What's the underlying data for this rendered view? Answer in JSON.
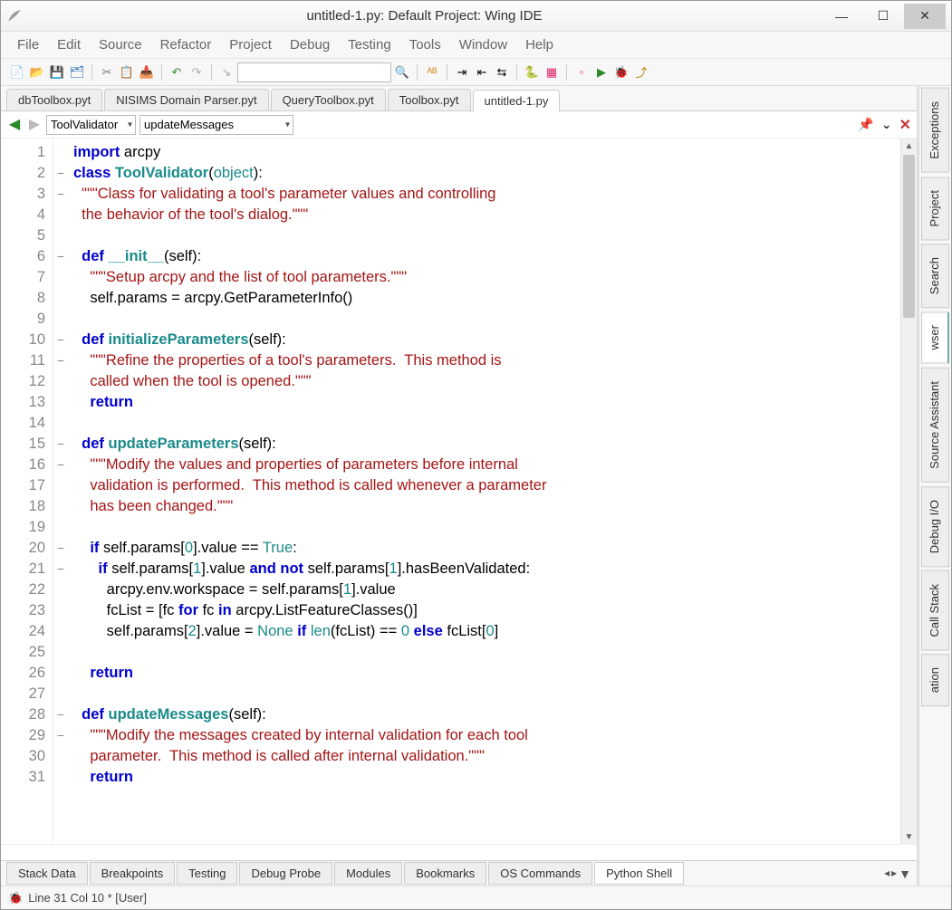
{
  "window": {
    "title": "untitled-1.py: Default Project: Wing IDE"
  },
  "menus": [
    "File",
    "Edit",
    "Source",
    "Refactor",
    "Project",
    "Debug",
    "Testing",
    "Tools",
    "Window",
    "Help"
  ],
  "tabs_top": [
    {
      "label": "dbToolbox.pyt",
      "active": false
    },
    {
      "label": "NISIMS Domain Parser.pyt",
      "active": false
    },
    {
      "label": "QueryToolbox.pyt",
      "active": false
    },
    {
      "label": "Toolbox.pyt",
      "active": false
    },
    {
      "label": "untitled-1.py",
      "active": true
    }
  ],
  "nav": {
    "scope1": "ToolValidator",
    "scope2": "updateMessages"
  },
  "code": {
    "lines": [
      {
        "n": 1,
        "fold": "",
        "html": "<span class='kw'>import</span> arcpy"
      },
      {
        "n": 2,
        "fold": "−",
        "html": "<span class='kw'>class</span> <span class='cls'>ToolValidator</span>(<span class='obj'>object</span>):"
      },
      {
        "n": 3,
        "fold": "−",
        "html": "  <span class='str'>\"\"\"Class for validating a tool's parameter values and controlling</span>"
      },
      {
        "n": 4,
        "fold": "",
        "html": "  <span class='str'>the behavior of the tool's dialog.\"\"\"</span>"
      },
      {
        "n": 5,
        "fold": "",
        "html": ""
      },
      {
        "n": 6,
        "fold": "−",
        "html": "  <span class='kw'>def</span> <span class='fn'>__init__</span>(self):"
      },
      {
        "n": 7,
        "fold": "",
        "html": "    <span class='str'>\"\"\"Setup arcpy and the list of tool parameters.\"\"\"</span>"
      },
      {
        "n": 8,
        "fold": "",
        "html": "    self.params = arcpy.GetParameterInfo()"
      },
      {
        "n": 9,
        "fold": "",
        "html": ""
      },
      {
        "n": 10,
        "fold": "−",
        "html": "  <span class='kw'>def</span> <span class='fn'>initializeParameters</span>(self):"
      },
      {
        "n": 11,
        "fold": "−",
        "html": "    <span class='str'>\"\"\"Refine the properties of a tool's parameters.  This method is</span>"
      },
      {
        "n": 12,
        "fold": "",
        "html": "    <span class='str'>called when the tool is opened.\"\"\"</span>"
      },
      {
        "n": 13,
        "fold": "",
        "html": "    <span class='kw'>return</span>"
      },
      {
        "n": 14,
        "fold": "",
        "html": ""
      },
      {
        "n": 15,
        "fold": "−",
        "html": "  <span class='kw'>def</span> <span class='fn'>updateParameters</span>(self):"
      },
      {
        "n": 16,
        "fold": "−",
        "html": "    <span class='str'>\"\"\"Modify the values and properties of parameters before internal</span>"
      },
      {
        "n": 17,
        "fold": "",
        "html": "    <span class='str'>validation is performed.  This method is called whenever a parameter</span>"
      },
      {
        "n": 18,
        "fold": "",
        "html": "    <span class='str'>has been changed.\"\"\"</span>"
      },
      {
        "n": 19,
        "fold": "",
        "html": ""
      },
      {
        "n": 20,
        "fold": "−",
        "html": "    <span class='kw'>if</span> self.params[<span class='num'>0</span>].value == <span class='bool'>True</span>:"
      },
      {
        "n": 21,
        "fold": "−",
        "html": "      <span class='kw'>if</span> self.params[<span class='num'>1</span>].value <span class='kw'>and</span> <span class='kw'>not</span> self.params[<span class='num'>1</span>].hasBeenValidated:"
      },
      {
        "n": 22,
        "fold": "",
        "html": "        arcpy.env.workspace = self.params[<span class='num'>1</span>].value"
      },
      {
        "n": 23,
        "fold": "",
        "html": "        fcList = [fc <span class='kw'>for</span> fc <span class='kw'>in</span> arcpy.ListFeatureClasses()]"
      },
      {
        "n": 24,
        "fold": "",
        "html": "        self.params[<span class='num'>2</span>].value = <span class='bool'>None</span> <span class='kw'>if</span> <span class='obj'>len</span>(fcList) == <span class='num'>0</span> <span class='kw'>else</span> fcList[<span class='num'>0</span>]"
      },
      {
        "n": 25,
        "fold": "",
        "html": ""
      },
      {
        "n": 26,
        "fold": "",
        "html": "    <span class='kw'>return</span>"
      },
      {
        "n": 27,
        "fold": "",
        "html": ""
      },
      {
        "n": 28,
        "fold": "−",
        "html": "  <span class='kw'>def</span> <span class='fn'>updateMessages</span>(self):"
      },
      {
        "n": 29,
        "fold": "−",
        "html": "    <span class='str'>\"\"\"Modify the messages created by internal validation for each tool</span>"
      },
      {
        "n": 30,
        "fold": "",
        "html": "    <span class='str'>parameter.  This method is called after internal validation.\"\"\"</span>"
      },
      {
        "n": 31,
        "fold": "",
        "html": "    <span class='kw'>return</span>"
      }
    ]
  },
  "tabs_bottom": [
    {
      "label": "Stack Data",
      "active": false
    },
    {
      "label": "Breakpoints",
      "active": false
    },
    {
      "label": "Testing",
      "active": false
    },
    {
      "label": "Debug Probe",
      "active": false
    },
    {
      "label": "Modules",
      "active": false
    },
    {
      "label": "Bookmarks",
      "active": false
    },
    {
      "label": "OS Commands",
      "active": false
    },
    {
      "label": "Python Shell",
      "active": true
    }
  ],
  "right_panels": [
    "Exceptions",
    "Project",
    "Search",
    "wser",
    "Source Assistant",
    "Debug I/O",
    "Call Stack",
    "ation"
  ],
  "status": {
    "text": "Line 31 Col 10 * [User]"
  }
}
